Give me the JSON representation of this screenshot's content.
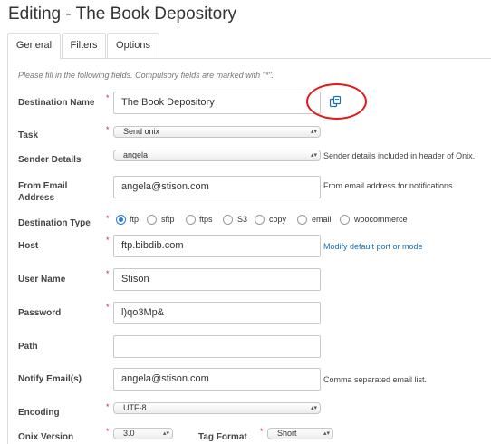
{
  "page_title": "Editing - The Book Depository",
  "tabs": [
    {
      "label": "General",
      "active": true
    },
    {
      "label": "Filters",
      "active": false
    },
    {
      "label": "Options",
      "active": false
    }
  ],
  "hint": "Please fill in the following fields. Compulsory fields are marked with \"*\".",
  "required_marker": "*",
  "fields": {
    "destination_name": {
      "label": "Destination Name",
      "value": "The Book Depository"
    },
    "task": {
      "label": "Task",
      "value": "Send onix"
    },
    "sender_details": {
      "label": "Sender Details",
      "value": "angela",
      "note": "Sender details included in header of Onix."
    },
    "from_email": {
      "label": "From Email Address",
      "value": "angela@stison.com",
      "note": "From email address for notifications"
    },
    "destination_type": {
      "label": "Destination Type",
      "options": [
        "ftp",
        "sftp",
        "ftps",
        "S3",
        "copy",
        "email",
        "woocommerce"
      ],
      "selected": "ftp"
    },
    "host": {
      "label": "Host",
      "value": "ftp.bibdib.com",
      "link": "Modify default port or mode"
    },
    "user_name": {
      "label": "User Name",
      "value": "Stison"
    },
    "password": {
      "label": "Password",
      "value": "l)qo3Mp&"
    },
    "path": {
      "label": "Path",
      "value": ""
    },
    "notify_emails": {
      "label": "Notify Email(s)",
      "value": "angela@stison.com",
      "note": "Comma separated email list."
    },
    "encoding": {
      "label": "Encoding",
      "value": "UTF-8"
    },
    "onix_version": {
      "label": "Onix Version",
      "value": "3.0"
    },
    "tag_format": {
      "label": "Tag Format",
      "value": "Short"
    }
  },
  "icons": {
    "copy": "copy-icon",
    "select_arrows": "updown-arrows-icon"
  },
  "colors": {
    "required": "#d9232e",
    "link": "#1a6fb5",
    "radio_selected": "#2a7ad6",
    "annotation_circle": "#e01a1a"
  }
}
